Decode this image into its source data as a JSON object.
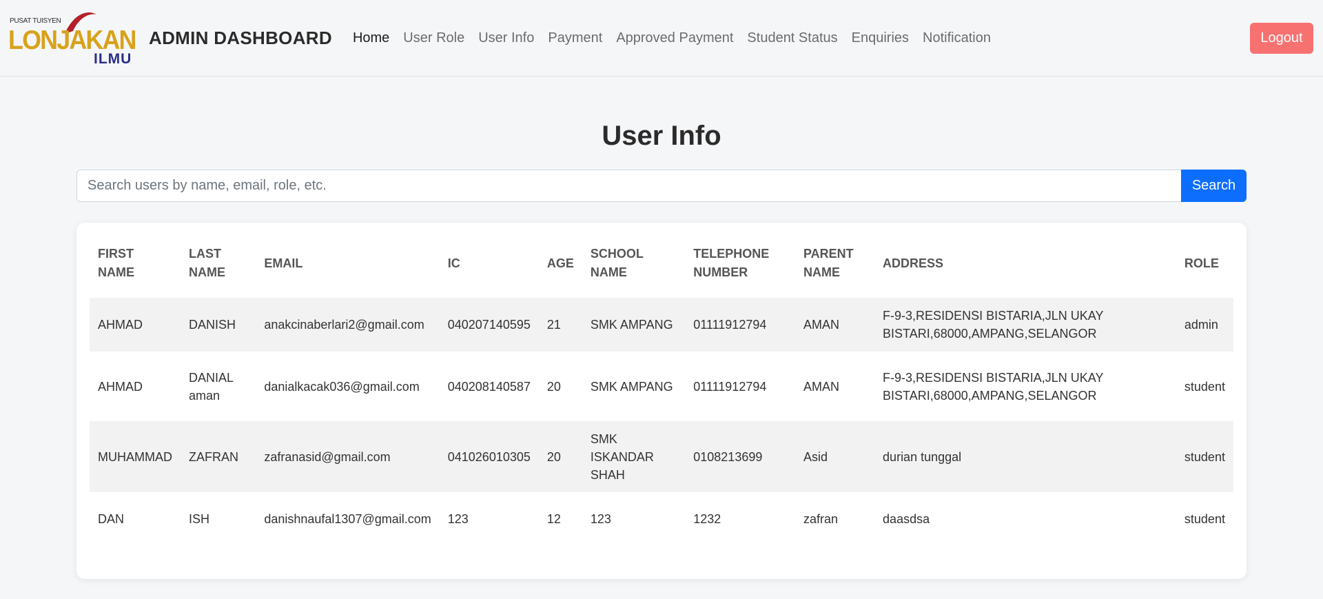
{
  "logo": {
    "top_text": "PUSAT TUISYEN",
    "main_text": "LONJAKAN",
    "sub_text": "ILMU"
  },
  "brand": "ADMIN DASHBOARD",
  "nav": [
    {
      "label": "Home",
      "active": true
    },
    {
      "label": "User Role"
    },
    {
      "label": "User Info"
    },
    {
      "label": "Payment"
    },
    {
      "label": "Approved Payment"
    },
    {
      "label": "Student Status"
    },
    {
      "label": "Enquiries"
    },
    {
      "label": "Notification"
    }
  ],
  "logout_label": "Logout",
  "page_title": "User Info",
  "search": {
    "placeholder": "Search users by name, email, role, etc.",
    "button_label": "Search"
  },
  "table": {
    "headers": [
      "FIRST NAME",
      "LAST NAME",
      "EMAIL",
      "IC",
      "AGE",
      "SCHOOL NAME",
      "TELEPHONE NUMBER",
      "PARENT NAME",
      "ADDRESS",
      "ROLE"
    ],
    "rows": [
      [
        "AHMAD",
        "DANISH",
        "anakcinaberlari2@gmail.com",
        "040207140595",
        "21",
        "SMK AMPANG",
        "01111912794",
        "AMAN",
        "F-9-3,RESIDENSI BISTARIA,JLN UKAY BISTARI,68000,AMPANG,SELANGOR",
        "admin"
      ],
      [
        "AHMAD",
        "DANIAL aman",
        "danialkacak036@gmail.com",
        "040208140587",
        "20",
        "SMK AMPANG",
        "01111912794",
        "AMAN",
        "F-9-3,RESIDENSI BISTARIA,JLN UKAY BISTARI,68000,AMPANG,SELANGOR",
        "student"
      ],
      [
        "MUHAMMAD",
        "ZAFRAN",
        "zafranasid@gmail.com",
        "041026010305",
        "20",
        "SMK ISKANDAR SHAH",
        "0108213699",
        "Asid",
        "durian tunggal",
        "student"
      ],
      [
        "DAN",
        "ISH",
        "danishnaufal1307@gmail.com",
        "123",
        "12",
        "123",
        "1232",
        "zafran",
        "daasdsa",
        "student"
      ]
    ]
  },
  "colors": {
    "logout": "#f87171",
    "search_button": "#0d6efd",
    "logo_gold": "#d8a21c",
    "logo_navy": "#2a2f8a",
    "logo_swoosh": "#b3202a"
  }
}
